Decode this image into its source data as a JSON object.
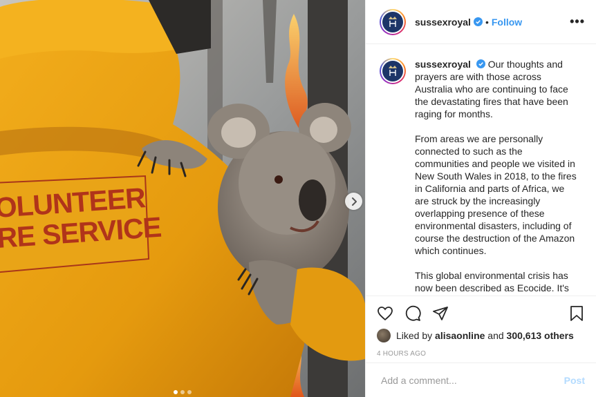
{
  "post": {
    "username": "sussexroyal",
    "verified_icon": "verified-badge-icon",
    "separator": "•",
    "follow_label": "Follow",
    "more_label": "•••"
  },
  "media": {
    "jacket_line1": "OLUNTEER",
    "jacket_line2": "RE SERVICE",
    "next_icon": "chevron-right-icon",
    "carousel_count": 3,
    "carousel_active": 1
  },
  "caption": {
    "username": "sussexroyal",
    "paragraphs": [
      "Our thoughts and prayers are with those across Australia who are continuing to face the devastating fires that have been raging for months.",
      "From areas we are personally connected to such as the communities and people we visited in New South Wales in 2018, to the fires in California and parts of Africa, we are struck by the increasingly overlapping presence of these environmental disasters, including of course the destruction of the Amazon which continues.",
      "This global environmental crisis has now been described as Ecocide. It's easy to feel helpless, but there's"
    ]
  },
  "actions": {
    "like_icon": "heart-icon",
    "comment_icon": "comment-icon",
    "share_icon": "share-icon",
    "save_icon": "bookmark-icon"
  },
  "likes": {
    "prefix": "Liked by",
    "user": "alisaonline",
    "middle": "and",
    "others": "300,613 others"
  },
  "timestamp": "4 HOURS AGO",
  "comment_box": {
    "placeholder": "Add a comment...",
    "post_label": "Post"
  },
  "colors": {
    "accent": "#3897f0",
    "post_disabled": "#b3dbff",
    "jacket": "#e8a20f",
    "jacket_text": "#b0341a"
  }
}
